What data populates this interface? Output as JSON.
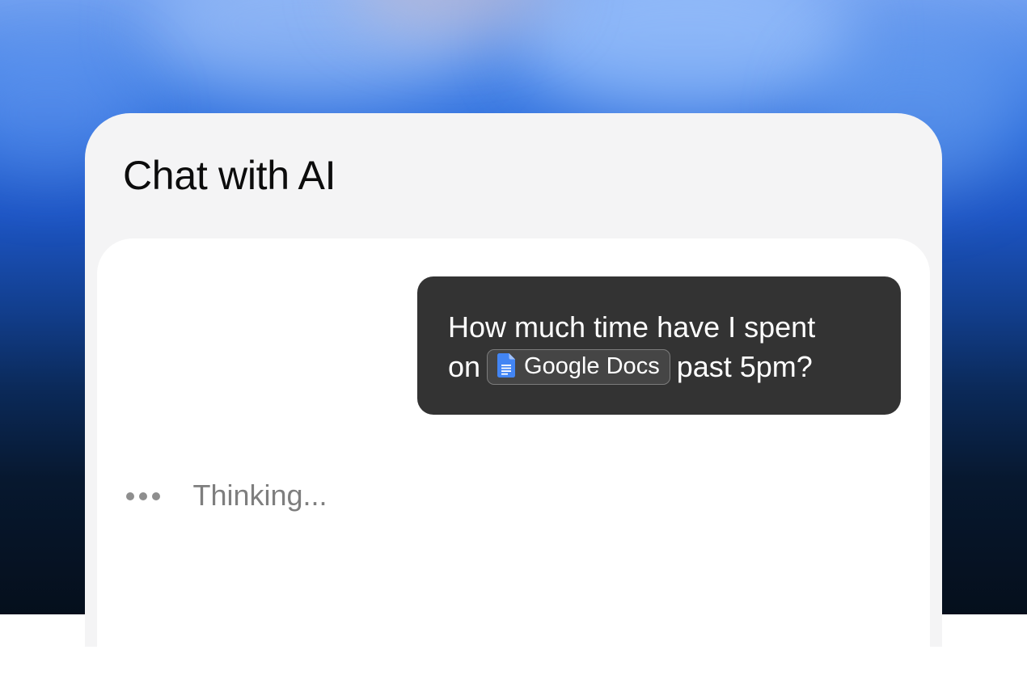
{
  "header": {
    "title": "Chat with AI"
  },
  "conversation": {
    "user_message": {
      "line1": "How much time have I spent",
      "line2_prefix": "on",
      "app_chip": {
        "label": "Google Docs",
        "icon": "google-docs-icon"
      },
      "line2_suffix": "past 5pm?"
    },
    "assistant_status": {
      "text": "Thinking...",
      "icon": "typing-dots-icon"
    }
  },
  "colors": {
    "panel_background": "#f4f4f5",
    "chat_background": "#ffffff",
    "user_bubble": "#333333",
    "docs_blue": "#4285f4",
    "thinking_text": "#7e7e7e"
  }
}
